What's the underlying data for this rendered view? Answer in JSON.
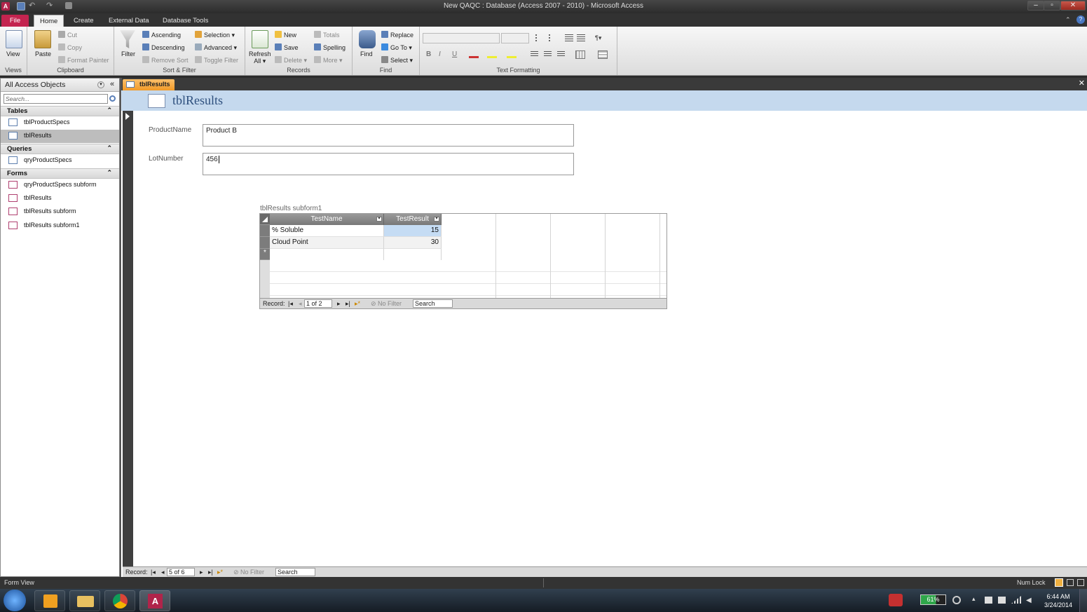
{
  "window": {
    "title": "New QAQC : Database (Access 2007 - 2010) - Microsoft Access"
  },
  "ribbon_tabs": [
    "File",
    "Home",
    "Create",
    "External Data",
    "Database Tools"
  ],
  "ribbon": {
    "views": {
      "view_label": "View",
      "group": "Views"
    },
    "clipboard": {
      "paste": "Paste",
      "cut": "Cut",
      "copy": "Copy",
      "format_painter": "Format Painter",
      "group": "Clipboard"
    },
    "sort_filter": {
      "filter": "Filter",
      "ascending": "Ascending",
      "descending": "Descending",
      "remove_sort": "Remove Sort",
      "selection": "Selection",
      "advanced": "Advanced",
      "toggle_filter": "Toggle Filter",
      "group": "Sort & Filter"
    },
    "records": {
      "refresh": "Refresh",
      "refresh_all": "All",
      "new": "New",
      "save": "Save",
      "delete": "Delete",
      "totals": "Totals",
      "spelling": "Spelling",
      "more": "More",
      "group": "Records"
    },
    "find": {
      "find": "Find",
      "replace": "Replace",
      "go_to": "Go To",
      "select": "Select",
      "group": "Find"
    },
    "text_formatting": {
      "group": "Text Formatting",
      "bold": "B",
      "italic": "I",
      "underline": "U"
    }
  },
  "nav_pane": {
    "title": "All Access Objects",
    "search_placeholder": "Search...",
    "sections": [
      {
        "name": "Tables",
        "items": [
          "tblProductSpecs",
          "tblResults"
        ]
      },
      {
        "name": "Queries",
        "items": [
          "qryProductSpecs"
        ]
      },
      {
        "name": "Forms",
        "items": [
          "qryProductSpecs subform",
          "tblResults",
          "tblResults subform",
          "tblResults subform1"
        ]
      }
    ],
    "selected_item": "tblResults"
  },
  "document": {
    "tab_label": "tblResults",
    "form_title": "tblResults",
    "fields": [
      {
        "label": "ProductName",
        "value": "Product B"
      },
      {
        "label": "LotNumber",
        "value": "456"
      }
    ],
    "subform": {
      "caption": "tblResults subform1",
      "columns": [
        "TestName",
        "TestResult"
      ],
      "rows": [
        {
          "TestName": "% Soluble",
          "TestResult": "15"
        },
        {
          "TestName": "Cloud Point",
          "TestResult": "30"
        }
      ],
      "new_row_marker": "*",
      "navigator": {
        "label": "Record:",
        "position": "1 of 2",
        "filter": "No Filter",
        "search": "Search"
      }
    },
    "navigator": {
      "label": "Record:",
      "position": "5 of 6",
      "filter": "No Filter",
      "search": "Search"
    }
  },
  "status_bar": {
    "left": "Form View",
    "right": "Num Lock"
  },
  "taskbar": {
    "battery": "61%",
    "time": "6:44 AM",
    "date": "3/24/2014"
  },
  "colors": {
    "file_tab": "#c3244f",
    "doc_tab": "#f29a28",
    "form_header": "#c5d9ee",
    "selected_cell": "#c5dcf4"
  }
}
